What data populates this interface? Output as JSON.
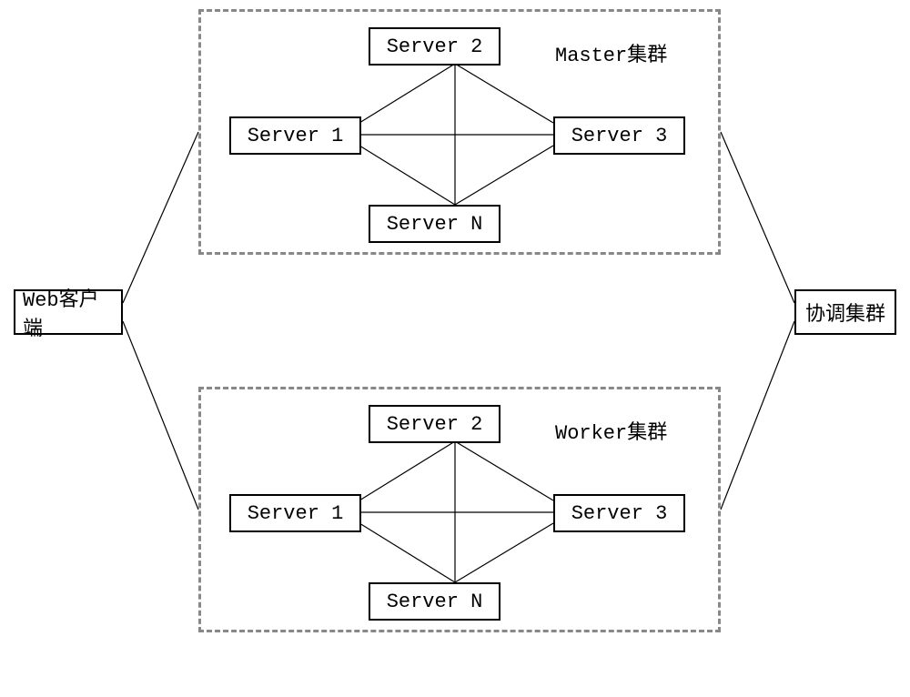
{
  "leftNode": "Web客户端",
  "rightNode": "协调集群",
  "masterCluster": {
    "label": "Master集群",
    "server1": "Server 1",
    "server2": "Server 2",
    "server3": "Server 3",
    "serverN": "Server N"
  },
  "workerCluster": {
    "label": "Worker集群",
    "server1": "Server 1",
    "server2": "Server 2",
    "server3": "Server 3",
    "serverN": "Server N"
  }
}
